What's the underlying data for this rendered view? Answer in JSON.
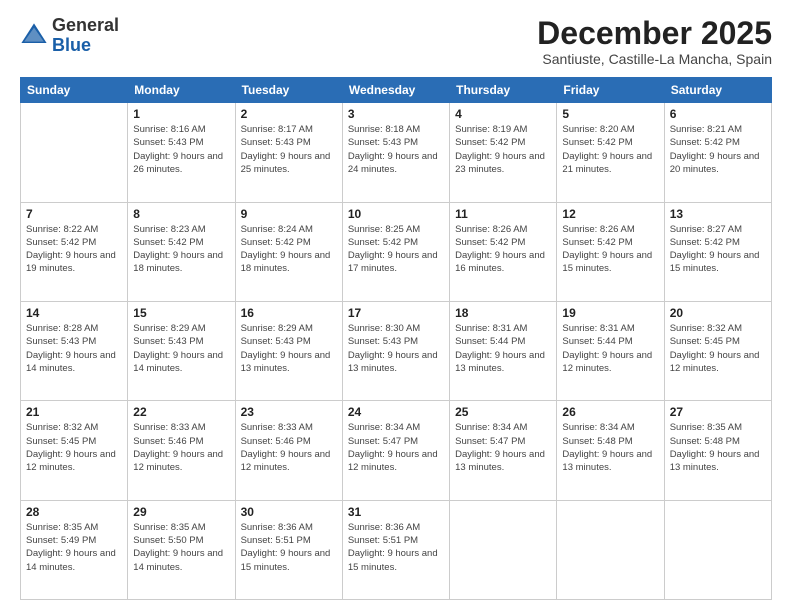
{
  "logo": {
    "general": "General",
    "blue": "Blue"
  },
  "header": {
    "month": "December 2025",
    "location": "Santiuste, Castille-La Mancha, Spain"
  },
  "weekdays": [
    "Sunday",
    "Monday",
    "Tuesday",
    "Wednesday",
    "Thursday",
    "Friday",
    "Saturday"
  ],
  "weeks": [
    [
      {
        "day": "",
        "sunrise": "",
        "sunset": "",
        "daylight": ""
      },
      {
        "day": "1",
        "sunrise": "Sunrise: 8:16 AM",
        "sunset": "Sunset: 5:43 PM",
        "daylight": "Daylight: 9 hours and 26 minutes."
      },
      {
        "day": "2",
        "sunrise": "Sunrise: 8:17 AM",
        "sunset": "Sunset: 5:43 PM",
        "daylight": "Daylight: 9 hours and 25 minutes."
      },
      {
        "day": "3",
        "sunrise": "Sunrise: 8:18 AM",
        "sunset": "Sunset: 5:43 PM",
        "daylight": "Daylight: 9 hours and 24 minutes."
      },
      {
        "day": "4",
        "sunrise": "Sunrise: 8:19 AM",
        "sunset": "Sunset: 5:42 PM",
        "daylight": "Daylight: 9 hours and 23 minutes."
      },
      {
        "day": "5",
        "sunrise": "Sunrise: 8:20 AM",
        "sunset": "Sunset: 5:42 PM",
        "daylight": "Daylight: 9 hours and 21 minutes."
      },
      {
        "day": "6",
        "sunrise": "Sunrise: 8:21 AM",
        "sunset": "Sunset: 5:42 PM",
        "daylight": "Daylight: 9 hours and 20 minutes."
      }
    ],
    [
      {
        "day": "7",
        "sunrise": "Sunrise: 8:22 AM",
        "sunset": "Sunset: 5:42 PM",
        "daylight": "Daylight: 9 hours and 19 minutes."
      },
      {
        "day": "8",
        "sunrise": "Sunrise: 8:23 AM",
        "sunset": "Sunset: 5:42 PM",
        "daylight": "Daylight: 9 hours and 18 minutes."
      },
      {
        "day": "9",
        "sunrise": "Sunrise: 8:24 AM",
        "sunset": "Sunset: 5:42 PM",
        "daylight": "Daylight: 9 hours and 18 minutes."
      },
      {
        "day": "10",
        "sunrise": "Sunrise: 8:25 AM",
        "sunset": "Sunset: 5:42 PM",
        "daylight": "Daylight: 9 hours and 17 minutes."
      },
      {
        "day": "11",
        "sunrise": "Sunrise: 8:26 AM",
        "sunset": "Sunset: 5:42 PM",
        "daylight": "Daylight: 9 hours and 16 minutes."
      },
      {
        "day": "12",
        "sunrise": "Sunrise: 8:26 AM",
        "sunset": "Sunset: 5:42 PM",
        "daylight": "Daylight: 9 hours and 15 minutes."
      },
      {
        "day": "13",
        "sunrise": "Sunrise: 8:27 AM",
        "sunset": "Sunset: 5:42 PM",
        "daylight": "Daylight: 9 hours and 15 minutes."
      }
    ],
    [
      {
        "day": "14",
        "sunrise": "Sunrise: 8:28 AM",
        "sunset": "Sunset: 5:43 PM",
        "daylight": "Daylight: 9 hours and 14 minutes."
      },
      {
        "day": "15",
        "sunrise": "Sunrise: 8:29 AM",
        "sunset": "Sunset: 5:43 PM",
        "daylight": "Daylight: 9 hours and 14 minutes."
      },
      {
        "day": "16",
        "sunrise": "Sunrise: 8:29 AM",
        "sunset": "Sunset: 5:43 PM",
        "daylight": "Daylight: 9 hours and 13 minutes."
      },
      {
        "day": "17",
        "sunrise": "Sunrise: 8:30 AM",
        "sunset": "Sunset: 5:43 PM",
        "daylight": "Daylight: 9 hours and 13 minutes."
      },
      {
        "day": "18",
        "sunrise": "Sunrise: 8:31 AM",
        "sunset": "Sunset: 5:44 PM",
        "daylight": "Daylight: 9 hours and 13 minutes."
      },
      {
        "day": "19",
        "sunrise": "Sunrise: 8:31 AM",
        "sunset": "Sunset: 5:44 PM",
        "daylight": "Daylight: 9 hours and 12 minutes."
      },
      {
        "day": "20",
        "sunrise": "Sunrise: 8:32 AM",
        "sunset": "Sunset: 5:45 PM",
        "daylight": "Daylight: 9 hours and 12 minutes."
      }
    ],
    [
      {
        "day": "21",
        "sunrise": "Sunrise: 8:32 AM",
        "sunset": "Sunset: 5:45 PM",
        "daylight": "Daylight: 9 hours and 12 minutes."
      },
      {
        "day": "22",
        "sunrise": "Sunrise: 8:33 AM",
        "sunset": "Sunset: 5:46 PM",
        "daylight": "Daylight: 9 hours and 12 minutes."
      },
      {
        "day": "23",
        "sunrise": "Sunrise: 8:33 AM",
        "sunset": "Sunset: 5:46 PM",
        "daylight": "Daylight: 9 hours and 12 minutes."
      },
      {
        "day": "24",
        "sunrise": "Sunrise: 8:34 AM",
        "sunset": "Sunset: 5:47 PM",
        "daylight": "Daylight: 9 hours and 12 minutes."
      },
      {
        "day": "25",
        "sunrise": "Sunrise: 8:34 AM",
        "sunset": "Sunset: 5:47 PM",
        "daylight": "Daylight: 9 hours and 13 minutes."
      },
      {
        "day": "26",
        "sunrise": "Sunrise: 8:34 AM",
        "sunset": "Sunset: 5:48 PM",
        "daylight": "Daylight: 9 hours and 13 minutes."
      },
      {
        "day": "27",
        "sunrise": "Sunrise: 8:35 AM",
        "sunset": "Sunset: 5:48 PM",
        "daylight": "Daylight: 9 hours and 13 minutes."
      }
    ],
    [
      {
        "day": "28",
        "sunrise": "Sunrise: 8:35 AM",
        "sunset": "Sunset: 5:49 PM",
        "daylight": "Daylight: 9 hours and 14 minutes."
      },
      {
        "day": "29",
        "sunrise": "Sunrise: 8:35 AM",
        "sunset": "Sunset: 5:50 PM",
        "daylight": "Daylight: 9 hours and 14 minutes."
      },
      {
        "day": "30",
        "sunrise": "Sunrise: 8:36 AM",
        "sunset": "Sunset: 5:51 PM",
        "daylight": "Daylight: 9 hours and 15 minutes."
      },
      {
        "day": "31",
        "sunrise": "Sunrise: 8:36 AM",
        "sunset": "Sunset: 5:51 PM",
        "daylight": "Daylight: 9 hours and 15 minutes."
      },
      {
        "day": "",
        "sunrise": "",
        "sunset": "",
        "daylight": ""
      },
      {
        "day": "",
        "sunrise": "",
        "sunset": "",
        "daylight": ""
      },
      {
        "day": "",
        "sunrise": "",
        "sunset": "",
        "daylight": ""
      }
    ]
  ]
}
